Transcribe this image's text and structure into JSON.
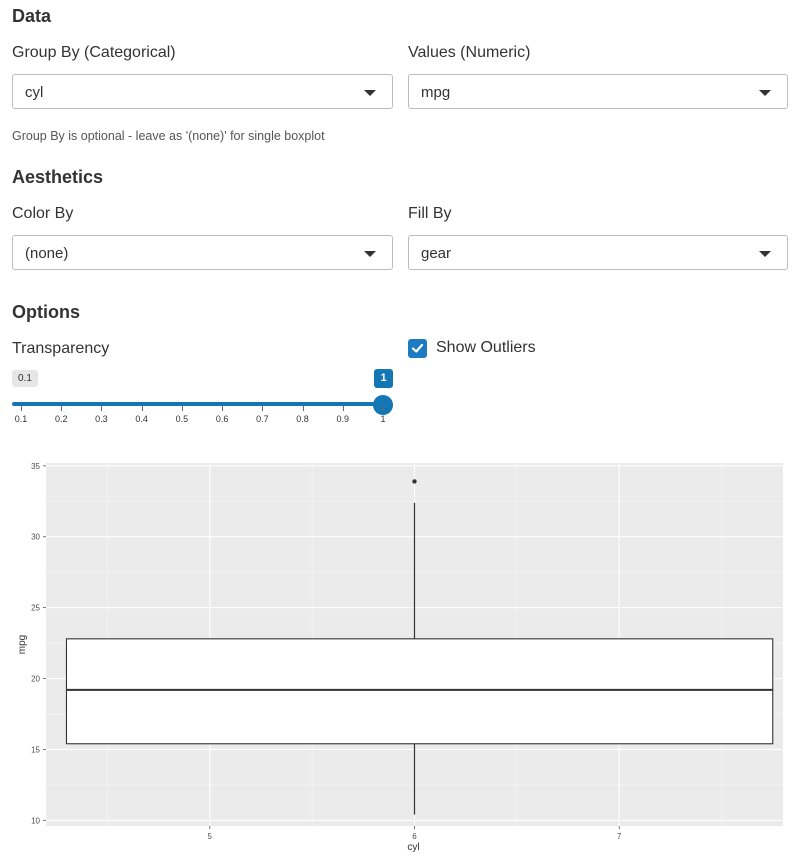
{
  "data_section": {
    "title": "Data",
    "group_by": {
      "label": "Group By (Categorical)",
      "value": "cyl"
    },
    "values": {
      "label": "Values (Numeric)",
      "value": "mpg"
    },
    "help_text": "Group By is optional - leave as '(none)' for single boxplot"
  },
  "aesthetics_section": {
    "title": "Aesthetics",
    "color_by": {
      "label": "Color By",
      "value": "(none)"
    },
    "fill_by": {
      "label": "Fill By",
      "value": "gear"
    }
  },
  "options_section": {
    "title": "Options",
    "transparency": {
      "label": "Transparency",
      "min_label": "0.1",
      "value_label": "1",
      "value": 1,
      "min": 0.1,
      "max": 1,
      "ticks": [
        "0.1",
        "0.2",
        "0.3",
        "0.4",
        "0.5",
        "0.6",
        "0.7",
        "0.8",
        "0.9",
        "1"
      ]
    },
    "show_outliers": {
      "label": "Show Outliers",
      "checked": true
    }
  },
  "colors": {
    "accent": "#1576b6",
    "panel_bg": "#ebebeb",
    "grid": "#ffffff"
  },
  "chart_data": {
    "type": "boxplot",
    "xlabel": "cyl",
    "ylabel": "mpg",
    "x_ticks": [
      5,
      6,
      7
    ],
    "y_ticks": [
      10,
      15,
      20,
      25,
      30,
      35
    ],
    "xlim": [
      4.2,
      7.8
    ],
    "ylim": [
      9.6,
      35.2
    ],
    "box": {
      "x_left": 4.3,
      "x_right": 7.75,
      "q1": 15.4,
      "median": 19.2,
      "q3": 22.8,
      "whisker_low": 10.4,
      "whisker_high": 32.4,
      "whisker_x": 6
    },
    "outliers": [
      {
        "x": 6,
        "y": 33.9
      }
    ]
  }
}
